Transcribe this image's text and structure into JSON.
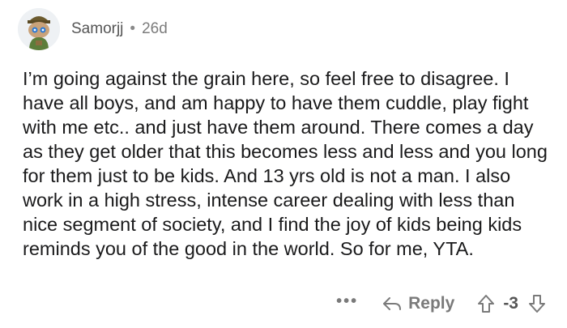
{
  "comment": {
    "author": "Samorjj",
    "separator": "•",
    "age": "26d",
    "avatar_icon": "snoo-avatar-icon",
    "body": "I’m going against the grain here, so feel free to disagree. I have all boys, and am happy to have them cuddle, play fight with me etc.. and just have them around. There comes a day as they get older that this becomes less and less and you long for them just to be kids. And 13 yrs old is not a man. I also work in a high stress, intense career dealing with less than nice segment of society, and I find the joy of kids being kids reminds you of the good in the world. So for me, YTA.",
    "actions": {
      "more": "•••",
      "reply": "Reply",
      "score": "-3"
    }
  }
}
